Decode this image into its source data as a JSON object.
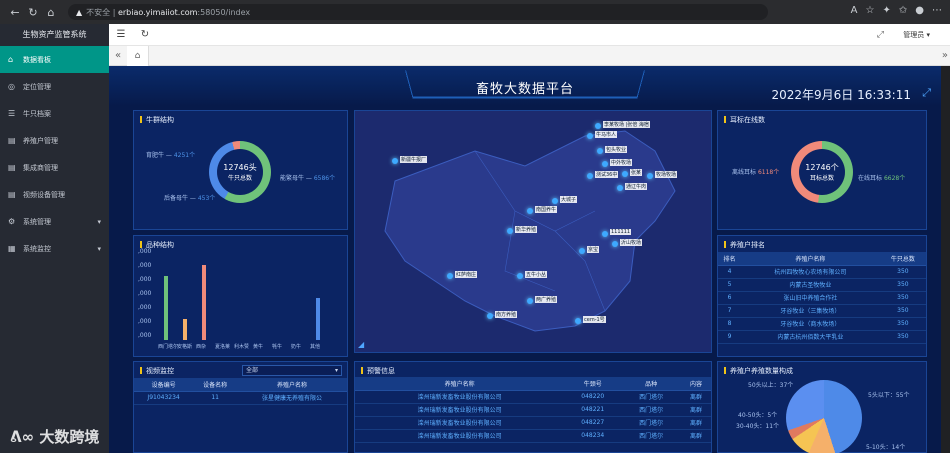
{
  "browser": {
    "insecure": "不安全",
    "url_host": "erbiao.yimaiiot.com",
    "url_path": ":58050/index"
  },
  "sidebar": {
    "title": "生物资产监管系统",
    "items": [
      {
        "label": "数据看板",
        "icon": "⌂",
        "active": true
      },
      {
        "label": "定位管理",
        "icon": "◎"
      },
      {
        "label": "牛只档案",
        "icon": "☰"
      },
      {
        "label": "养殖户管理",
        "icon": "▤"
      },
      {
        "label": "集成商管理",
        "icon": "▤"
      },
      {
        "label": "视频设备管理",
        "icon": "▤"
      },
      {
        "label": "系统管理",
        "icon": "⚙",
        "caret": true
      },
      {
        "label": "系统监控",
        "icon": "▦",
        "caret": true
      }
    ]
  },
  "topbar": {
    "user": "管理员 ▾"
  },
  "dashboard": {
    "title": "畜牧大数据平台",
    "datetime": "2022年9月6日 16:33:11",
    "herd": {
      "title": "牛群结构",
      "total": "12746头",
      "total_label": "牛只总数",
      "label1": "育肥牛",
      "value1": "4251个",
      "label2": "后备母牛",
      "value2": "453个",
      "label3": "能繁母牛",
      "value3": "6586个"
    },
    "ear": {
      "title": "耳标在线数",
      "total": "12746个",
      "total_label": "耳标总数",
      "off_label": "离线耳标",
      "off_value": "6118个",
      "on_label": "在线耳标",
      "on_value": "6628个"
    },
    "breed": {
      "title": "品种结构",
      "y_ticks": [
        ",000",
        ",000",
        ",000",
        ",000",
        ",000",
        ",000",
        ",000"
      ],
      "x_labels": [
        "西门塔尔",
        "安格斯",
        "西杂",
        "夏洛莱",
        "利木赞",
        "黄牛",
        "牦牛",
        "奶牛",
        "其他"
      ]
    },
    "map": {
      "labels": [
        "李某牧场 |张倍 海宿",
        "牛马市人",
        "包头牧业",
        "新疆牛报厂",
        "中外牧场",
        "测试36中",
        "张某",
        "牧场牧场",
        "通辽牛肉",
        "大城子",
        "南国养牛",
        "新华养殖",
        "111111",
        "京宝",
        "沂山牧场",
        "五牛小丛",
        "红萨南庄",
        "两广养殖",
        "南方养殖",
        "cem-1号"
      ]
    },
    "ranking": {
      "title": "养殖户排名",
      "headers": [
        "排名",
        "养殖户名称",
        "牛只总数"
      ],
      "rows": [
        [
          "4",
          "杭州四牧牧心农场有限公司",
          "350"
        ],
        [
          "5",
          "内蒙古圣牧牧业",
          "350"
        ],
        [
          "6",
          "张山旧中养殖合作社",
          "350"
        ],
        [
          "7",
          "牙谷牧业（三集牧场）",
          "350"
        ],
        [
          "8",
          "牙谷牧业（商水牧场）",
          "350"
        ],
        [
          "9",
          "内蒙古杭州佰数大平乳业",
          "350"
        ]
      ]
    },
    "video": {
      "title": "视频监控",
      "select": "全部",
      "headers": [
        "设备编号",
        "设备名称",
        "养殖户名称"
      ],
      "rows": [
        [
          "J91043234",
          "11",
          "张星健康无养殖有限公"
        ]
      ]
    },
    "alerts": {
      "title": "预警信息",
      "headers": [
        "养殖户名称",
        "牛颈号",
        "品种",
        "内容"
      ],
      "rows": [
        [
          "滦州瑞新发畜牧业股份有限公司",
          "048220",
          "西门塔尔",
          "离群"
        ],
        [
          "滦州瑞新发畜牧业股份有限公司",
          "048221",
          "西门塔尔",
          "离群"
        ],
        [
          "滦州瑞新发畜牧业股份有限公司",
          "048227",
          "西门塔尔",
          "离群"
        ],
        [
          "滦州瑞新发畜牧业股份有限公司",
          "048234",
          "西门塔尔",
          "离群"
        ]
      ]
    },
    "scale": {
      "title": "养殖户养殖数量构成",
      "l1": "50头以上：37个",
      "l2": "5头以下：55个",
      "l3": "40-50头：5个",
      "l4": "30-40头：11个",
      "l5": "5-10头：14个"
    }
  },
  "watermark": "大数跨境",
  "chart_data": [
    {
      "type": "pie",
      "title": "牛群结构",
      "categories": [
        "能繁母牛",
        "育肥牛",
        "后备母牛"
      ],
      "values": [
        6586,
        4251,
        453
      ]
    },
    {
      "type": "pie",
      "title": "耳标在线数",
      "categories": [
        "在线耳标",
        "离线耳标"
      ],
      "values": [
        6628,
        6118
      ]
    },
    {
      "type": "bar",
      "title": "品种结构",
      "categories": [
        "西门塔尔",
        "安格斯",
        "西杂",
        "夏洛莱",
        "利木赞",
        "黄牛",
        "牦牛",
        "奶牛",
        "其他"
      ],
      "values": [
        0.75,
        0.25,
        0.87,
        0,
        0,
        0,
        0,
        0,
        0.49
      ],
      "colors": [
        "#6fc27a",
        "#f5b06a",
        "#f08a7a",
        "#4e8ae8",
        "#4e8ae8",
        "#4e8ae8",
        "#4e8ae8",
        "#4e8ae8",
        "#4e8ae8"
      ]
    },
    {
      "type": "pie",
      "title": "养殖户养殖数量构成",
      "categories": [
        "5头以下",
        "5-10头",
        "30-40头",
        "40-50头",
        "50头以上"
      ],
      "values": [
        55,
        14,
        11,
        5,
        37
      ]
    }
  ]
}
